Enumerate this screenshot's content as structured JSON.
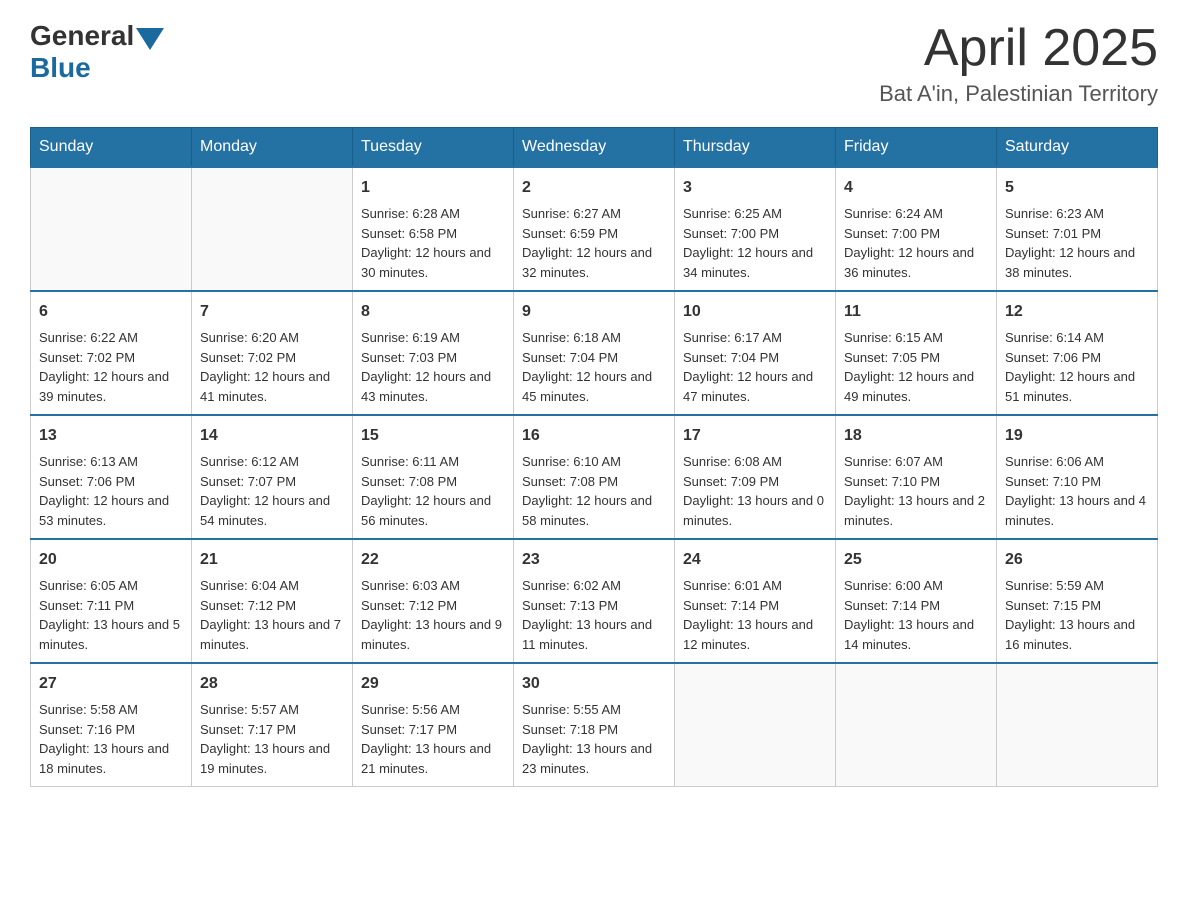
{
  "header": {
    "logo_general": "General",
    "logo_blue": "Blue",
    "title": "April 2025",
    "subtitle": "Bat A'in, Palestinian Territory"
  },
  "weekdays": [
    "Sunday",
    "Monday",
    "Tuesday",
    "Wednesday",
    "Thursday",
    "Friday",
    "Saturday"
  ],
  "weeks": [
    [
      {
        "day": "",
        "sunrise": "",
        "sunset": "",
        "daylight": ""
      },
      {
        "day": "",
        "sunrise": "",
        "sunset": "",
        "daylight": ""
      },
      {
        "day": "1",
        "sunrise": "Sunrise: 6:28 AM",
        "sunset": "Sunset: 6:58 PM",
        "daylight": "Daylight: 12 hours and 30 minutes."
      },
      {
        "day": "2",
        "sunrise": "Sunrise: 6:27 AM",
        "sunset": "Sunset: 6:59 PM",
        "daylight": "Daylight: 12 hours and 32 minutes."
      },
      {
        "day": "3",
        "sunrise": "Sunrise: 6:25 AM",
        "sunset": "Sunset: 7:00 PM",
        "daylight": "Daylight: 12 hours and 34 minutes."
      },
      {
        "day": "4",
        "sunrise": "Sunrise: 6:24 AM",
        "sunset": "Sunset: 7:00 PM",
        "daylight": "Daylight: 12 hours and 36 minutes."
      },
      {
        "day": "5",
        "sunrise": "Sunrise: 6:23 AM",
        "sunset": "Sunset: 7:01 PM",
        "daylight": "Daylight: 12 hours and 38 minutes."
      }
    ],
    [
      {
        "day": "6",
        "sunrise": "Sunrise: 6:22 AM",
        "sunset": "Sunset: 7:02 PM",
        "daylight": "Daylight: 12 hours and 39 minutes."
      },
      {
        "day": "7",
        "sunrise": "Sunrise: 6:20 AM",
        "sunset": "Sunset: 7:02 PM",
        "daylight": "Daylight: 12 hours and 41 minutes."
      },
      {
        "day": "8",
        "sunrise": "Sunrise: 6:19 AM",
        "sunset": "Sunset: 7:03 PM",
        "daylight": "Daylight: 12 hours and 43 minutes."
      },
      {
        "day": "9",
        "sunrise": "Sunrise: 6:18 AM",
        "sunset": "Sunset: 7:04 PM",
        "daylight": "Daylight: 12 hours and 45 minutes."
      },
      {
        "day": "10",
        "sunrise": "Sunrise: 6:17 AM",
        "sunset": "Sunset: 7:04 PM",
        "daylight": "Daylight: 12 hours and 47 minutes."
      },
      {
        "day": "11",
        "sunrise": "Sunrise: 6:15 AM",
        "sunset": "Sunset: 7:05 PM",
        "daylight": "Daylight: 12 hours and 49 minutes."
      },
      {
        "day": "12",
        "sunrise": "Sunrise: 6:14 AM",
        "sunset": "Sunset: 7:06 PM",
        "daylight": "Daylight: 12 hours and 51 minutes."
      }
    ],
    [
      {
        "day": "13",
        "sunrise": "Sunrise: 6:13 AM",
        "sunset": "Sunset: 7:06 PM",
        "daylight": "Daylight: 12 hours and 53 minutes."
      },
      {
        "day": "14",
        "sunrise": "Sunrise: 6:12 AM",
        "sunset": "Sunset: 7:07 PM",
        "daylight": "Daylight: 12 hours and 54 minutes."
      },
      {
        "day": "15",
        "sunrise": "Sunrise: 6:11 AM",
        "sunset": "Sunset: 7:08 PM",
        "daylight": "Daylight: 12 hours and 56 minutes."
      },
      {
        "day": "16",
        "sunrise": "Sunrise: 6:10 AM",
        "sunset": "Sunset: 7:08 PM",
        "daylight": "Daylight: 12 hours and 58 minutes."
      },
      {
        "day": "17",
        "sunrise": "Sunrise: 6:08 AM",
        "sunset": "Sunset: 7:09 PM",
        "daylight": "Daylight: 13 hours and 0 minutes."
      },
      {
        "day": "18",
        "sunrise": "Sunrise: 6:07 AM",
        "sunset": "Sunset: 7:10 PM",
        "daylight": "Daylight: 13 hours and 2 minutes."
      },
      {
        "day": "19",
        "sunrise": "Sunrise: 6:06 AM",
        "sunset": "Sunset: 7:10 PM",
        "daylight": "Daylight: 13 hours and 4 minutes."
      }
    ],
    [
      {
        "day": "20",
        "sunrise": "Sunrise: 6:05 AM",
        "sunset": "Sunset: 7:11 PM",
        "daylight": "Daylight: 13 hours and 5 minutes."
      },
      {
        "day": "21",
        "sunrise": "Sunrise: 6:04 AM",
        "sunset": "Sunset: 7:12 PM",
        "daylight": "Daylight: 13 hours and 7 minutes."
      },
      {
        "day": "22",
        "sunrise": "Sunrise: 6:03 AM",
        "sunset": "Sunset: 7:12 PM",
        "daylight": "Daylight: 13 hours and 9 minutes."
      },
      {
        "day": "23",
        "sunrise": "Sunrise: 6:02 AM",
        "sunset": "Sunset: 7:13 PM",
        "daylight": "Daylight: 13 hours and 11 minutes."
      },
      {
        "day": "24",
        "sunrise": "Sunrise: 6:01 AM",
        "sunset": "Sunset: 7:14 PM",
        "daylight": "Daylight: 13 hours and 12 minutes."
      },
      {
        "day": "25",
        "sunrise": "Sunrise: 6:00 AM",
        "sunset": "Sunset: 7:14 PM",
        "daylight": "Daylight: 13 hours and 14 minutes."
      },
      {
        "day": "26",
        "sunrise": "Sunrise: 5:59 AM",
        "sunset": "Sunset: 7:15 PM",
        "daylight": "Daylight: 13 hours and 16 minutes."
      }
    ],
    [
      {
        "day": "27",
        "sunrise": "Sunrise: 5:58 AM",
        "sunset": "Sunset: 7:16 PM",
        "daylight": "Daylight: 13 hours and 18 minutes."
      },
      {
        "day": "28",
        "sunrise": "Sunrise: 5:57 AM",
        "sunset": "Sunset: 7:17 PM",
        "daylight": "Daylight: 13 hours and 19 minutes."
      },
      {
        "day": "29",
        "sunrise": "Sunrise: 5:56 AM",
        "sunset": "Sunset: 7:17 PM",
        "daylight": "Daylight: 13 hours and 21 minutes."
      },
      {
        "day": "30",
        "sunrise": "Sunrise: 5:55 AM",
        "sunset": "Sunset: 7:18 PM",
        "daylight": "Daylight: 13 hours and 23 minutes."
      },
      {
        "day": "",
        "sunrise": "",
        "sunset": "",
        "daylight": ""
      },
      {
        "day": "",
        "sunrise": "",
        "sunset": "",
        "daylight": ""
      },
      {
        "day": "",
        "sunrise": "",
        "sunset": "",
        "daylight": ""
      }
    ]
  ]
}
